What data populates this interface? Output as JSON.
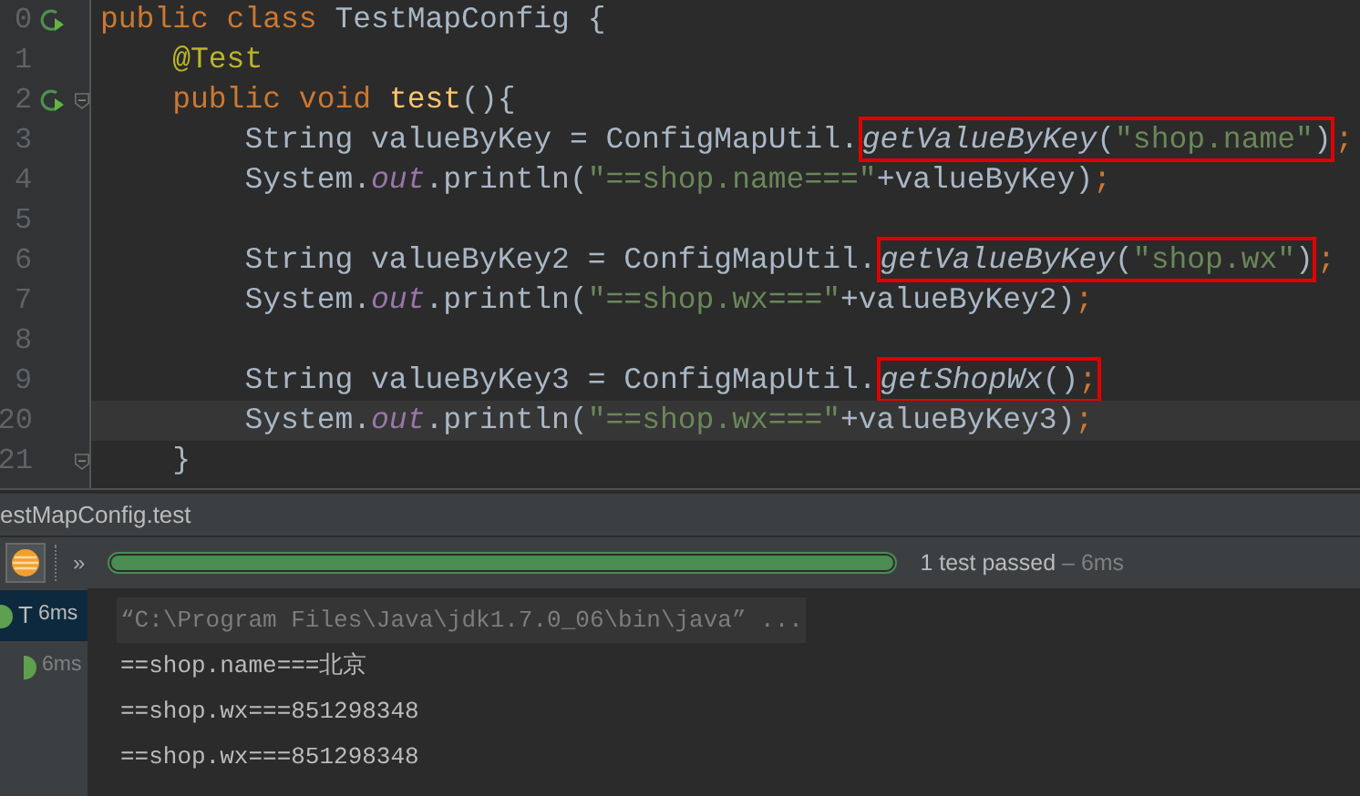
{
  "editor": {
    "lines": [
      {
        "number": "0",
        "run_icon": true,
        "fold": false,
        "tokens": [
          {
            "kind": "keyword",
            "text": "public class "
          },
          {
            "kind": "plain",
            "text": "TestMapConfig {"
          }
        ]
      },
      {
        "number": "1",
        "run_icon": false,
        "fold": false,
        "tokens": [
          {
            "kind": "annotation",
            "text": "    @Test"
          }
        ]
      },
      {
        "number": "2",
        "run_icon": true,
        "fold": true,
        "tokens": [
          {
            "kind": "keyword",
            "text": "    public void "
          },
          {
            "kind": "decl",
            "text": "test"
          },
          {
            "kind": "plain",
            "text": "(){"
          }
        ]
      },
      {
        "number": "3",
        "run_icon": false,
        "fold": false,
        "tokens": [
          {
            "kind": "plain",
            "text": "        String valueByKey = ConfigMapUtil."
          },
          {
            "kind": "box",
            "tokens": [
              {
                "kind": "static",
                "text": "getValueByKey"
              },
              {
                "kind": "plain",
                "text": "("
              },
              {
                "kind": "string",
                "text": "\"shop.name\""
              },
              {
                "kind": "plain",
                "text": ")"
              }
            ]
          },
          {
            "kind": "punct",
            "text": ";"
          }
        ]
      },
      {
        "number": "4",
        "run_icon": false,
        "fold": false,
        "tokens": [
          {
            "kind": "plain",
            "text": "        System."
          },
          {
            "kind": "field",
            "text": "out"
          },
          {
            "kind": "plain",
            "text": ".println("
          },
          {
            "kind": "string",
            "text": "\"==shop.name===\""
          },
          {
            "kind": "plain",
            "text": "+valueByKey)"
          },
          {
            "kind": "punct",
            "text": ";"
          }
        ]
      },
      {
        "number": "5",
        "run_icon": false,
        "fold": false
      },
      {
        "number": "6",
        "run_icon": false,
        "fold": false,
        "tokens": [
          {
            "kind": "plain",
            "text": "        String valueByKey2 = ConfigMapUtil."
          },
          {
            "kind": "box",
            "tokens": [
              {
                "kind": "static",
                "text": "getValueByKey"
              },
              {
                "kind": "plain",
                "text": "("
              },
              {
                "kind": "string",
                "text": "\"shop.wx\""
              },
              {
                "kind": "plain",
                "text": ")"
              }
            ]
          },
          {
            "kind": "punct",
            "text": ";"
          }
        ]
      },
      {
        "number": "7",
        "run_icon": false,
        "fold": false,
        "tokens": [
          {
            "kind": "plain",
            "text": "        System."
          },
          {
            "kind": "field",
            "text": "out"
          },
          {
            "kind": "plain",
            "text": ".println("
          },
          {
            "kind": "string",
            "text": "\"==shop.wx===\""
          },
          {
            "kind": "plain",
            "text": "+valueByKey2)"
          },
          {
            "kind": "punct",
            "text": ";"
          }
        ]
      },
      {
        "number": "8",
        "run_icon": false,
        "fold": false
      },
      {
        "number": "9",
        "run_icon": false,
        "fold": false,
        "tokens": [
          {
            "kind": "plain",
            "text": "        String valueByKey3 = ConfigMapUtil."
          },
          {
            "kind": "box",
            "tokens": [
              {
                "kind": "static",
                "text": "getShopWx"
              },
              {
                "kind": "plain",
                "text": "()"
              },
              {
                "kind": "punct",
                "text": ";"
              }
            ]
          }
        ]
      },
      {
        "number": "20",
        "run_icon": false,
        "fold": false,
        "current": true,
        "tokens": [
          {
            "kind": "plain",
            "text": "        System."
          },
          {
            "kind": "field",
            "text": "out"
          },
          {
            "kind": "plain",
            "text": ".println("
          },
          {
            "kind": "string",
            "text": "\"==shop.wx===\""
          },
          {
            "kind": "plain",
            "text": "+valueByKey3)"
          },
          {
            "kind": "punct",
            "text": ";"
          }
        ]
      },
      {
        "number": "21",
        "run_icon": false,
        "fold": true,
        "tokens": [
          {
            "kind": "plain",
            "text": "    }"
          }
        ]
      }
    ]
  },
  "run_panel": {
    "title": "estMapConfig.test",
    "overflow_button": "»",
    "progress": {
      "level": 1
    },
    "summary": "1 test passed",
    "duration": " – 6ms",
    "tree": [
      {
        "label": "T",
        "time": "6ms",
        "selected": true,
        "children": [
          {
            "time": "6ms",
            "selected": false
          }
        ]
      }
    ],
    "console": [
      {
        "kind": "command",
        "text": "“C:\\Program Files\\Java\\jdk1.7.0_06\\bin\\java” ..."
      },
      {
        "kind": "output",
        "text": "==shop.name===北京"
      },
      {
        "kind": "output",
        "text": "==shop.wx===851298348"
      },
      {
        "kind": "output",
        "text": "==shop.wx===851298348"
      }
    ]
  }
}
